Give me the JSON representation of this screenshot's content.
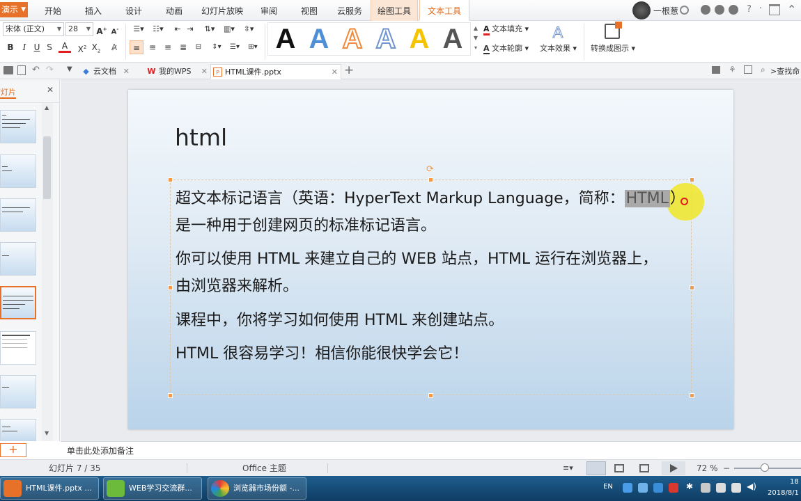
{
  "app": {
    "menu_button": "演示"
  },
  "menu_tabs": [
    "开始",
    "插入",
    "设计",
    "动画",
    "幻灯片放映",
    "审阅",
    "视图",
    "云服务",
    "绘图工具",
    "文本工具"
  ],
  "title_right": {
    "user": "一根葱"
  },
  "ribbon": {
    "font_name": "宋体 (正文)",
    "font_size": "28",
    "fill_label": "文本填充",
    "outline_label": "文本轮廓",
    "effect_label": "文本效果",
    "convert_label": "转换成图示",
    "wordart_colors": [
      "#111111",
      "#4f8fd6",
      "#f08a3c",
      "#6f94cf",
      "#f5c400",
      "#555555"
    ]
  },
  "doc_tabs": [
    {
      "label": "云文档"
    },
    {
      "label": "我的WPS"
    },
    {
      "label": "HTML课件.pptx"
    }
  ],
  "find_label": "查找命",
  "left_pane": {
    "title": "幻灯片"
  },
  "slide": {
    "title": "html",
    "para1_pre": "超文本标记语言（英语：HyperText Markup Language，简称：",
    "para1_sel": "HTML",
    "para1_post": "）",
    "para1_line2": "是一种用于创建网页的标准标记语言。",
    "para2_line1": "你可以使用 HTML 来建立自己的 WEB 站点，HTML 运行在浏览器上，",
    "para2_line2": "由浏览器来解析。",
    "para3": "课程中，你将学习如何使用 HTML 来创建站点。",
    "para4": "HTML 很容易学习！相信你能很快学会它！"
  },
  "notes_placeholder": "单击此处添加备注",
  "status": {
    "slide_count": "幻灯片 7 / 35",
    "theme": "Office 主题",
    "zoom": "72 %"
  },
  "taskbar": {
    "apps": [
      "HTML课件.pptx ...",
      "WEB学习交流群...",
      "浏览器市场份额 -..."
    ],
    "ime": "EN",
    "clock_time": "18",
    "clock_date": "2018/8/1"
  }
}
